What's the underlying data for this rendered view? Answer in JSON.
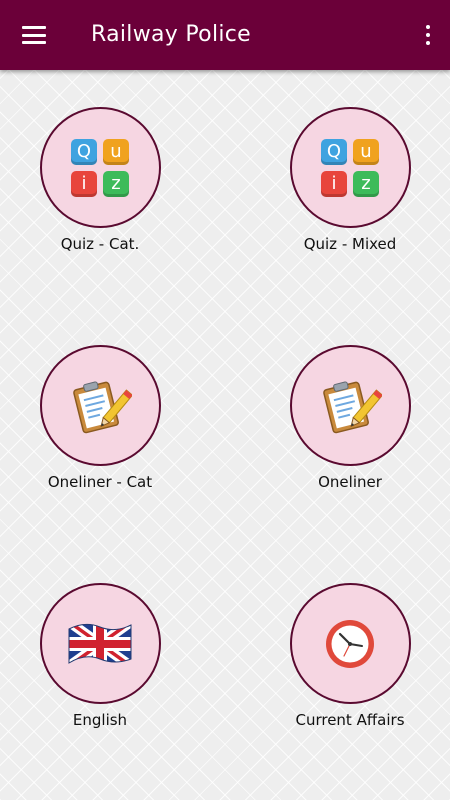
{
  "appbar": {
    "title": "Railway Police",
    "menu_icon": "hamburger-menu-icon",
    "overflow_icon": "more-vertical-icon",
    "color": "#6b0039"
  },
  "tiles": [
    {
      "label": "Quiz - Cat.",
      "icon": "quiz-icon"
    },
    {
      "label": "Quiz - Mixed",
      "icon": "quiz-icon"
    },
    {
      "label": "Oneliner - Cat",
      "icon": "clipboard-pencil-icon"
    },
    {
      "label": "Oneliner",
      "icon": "clipboard-pencil-icon"
    },
    {
      "label": "English",
      "icon": "uk-flag-icon"
    },
    {
      "label": "Current Affairs",
      "icon": "clock-icon"
    }
  ],
  "quiz_icon": {
    "letters": [
      "Q",
      "u",
      "i",
      "z"
    ],
    "colors": [
      "#3fa3e0",
      "#f0a21f",
      "#e8453c",
      "#3dbb5a"
    ]
  },
  "colors": {
    "circle_fill": "#f6d6e2",
    "circle_border": "#5a0a30",
    "clock_ring": "#e0493b"
  }
}
